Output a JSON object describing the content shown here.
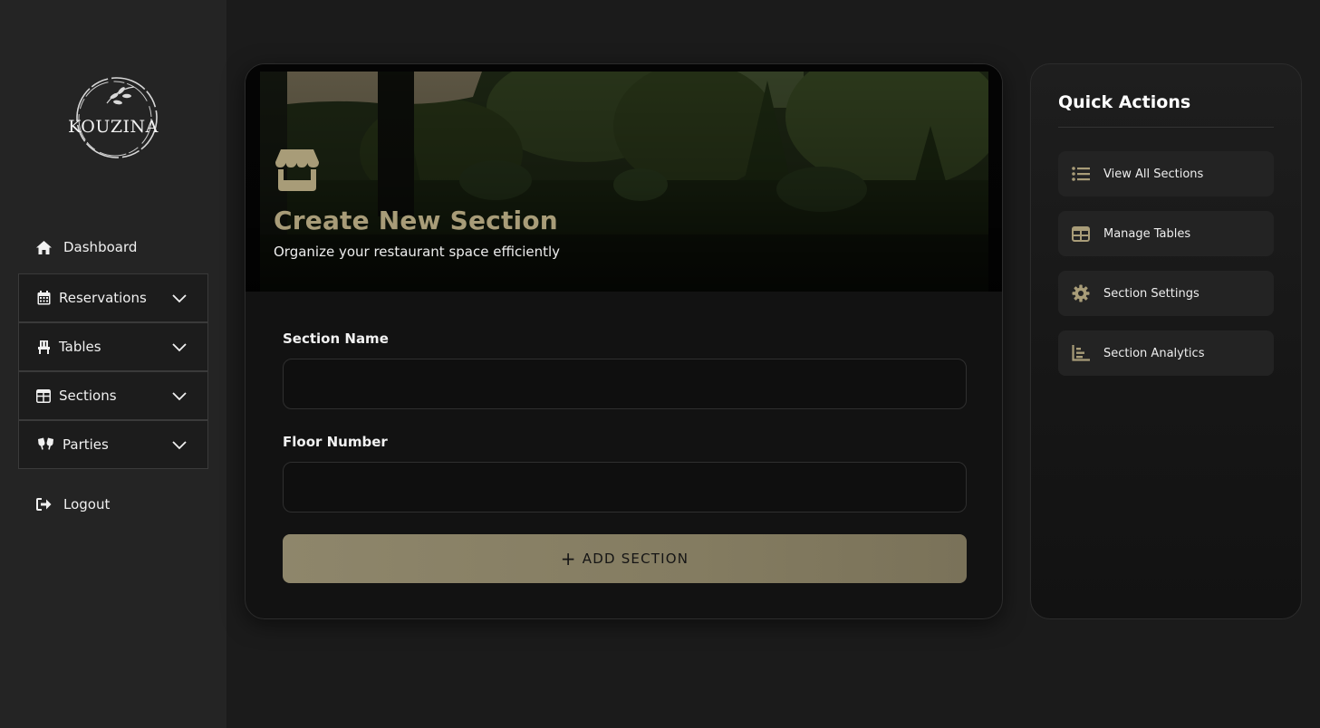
{
  "brand": {
    "logo_text": "KOUZINA",
    "accent_color": "#a89c78"
  },
  "sidebar": {
    "dashboard_label": "Dashboard",
    "items": [
      {
        "label": "Reservations",
        "icon": "calendar-icon"
      },
      {
        "label": "Tables",
        "icon": "chair-icon"
      },
      {
        "label": "Sections",
        "icon": "grid-icon"
      },
      {
        "label": "Parties",
        "icon": "cheers-icon"
      }
    ],
    "logout_label": "Logout"
  },
  "form": {
    "title": "Create New Section",
    "subtitle": "Organize your restaurant space efficiently",
    "section_name_label": "Section Name",
    "section_name_value": "",
    "floor_number_label": "Floor Number",
    "floor_number_value": "",
    "submit_label": "ADD SECTION",
    "submit_icon": "+"
  },
  "quick_actions": {
    "title": "Quick Actions",
    "items": [
      {
        "label": "View All Sections",
        "icon": "list-icon"
      },
      {
        "label": "Manage Tables",
        "icon": "table-grid-icon"
      },
      {
        "label": "Section Settings",
        "icon": "gear-icon"
      },
      {
        "label": "Section Analytics",
        "icon": "chart-icon"
      }
    ]
  }
}
